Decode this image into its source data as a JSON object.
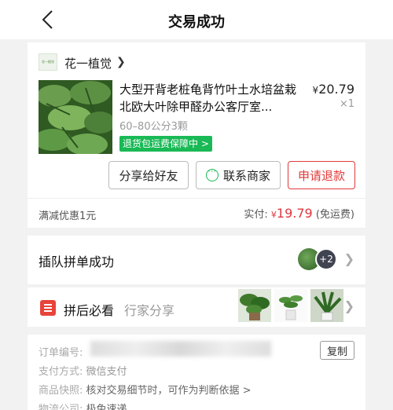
{
  "nav": {
    "title": "交易成功"
  },
  "shop": {
    "logo_text": "花一植觉",
    "name": "花一植觉"
  },
  "product": {
    "name": "大型开背老桩龟背竹叶土水培盆栽北欧大叶除甲醛办公客厅室...",
    "price_symbol": "¥",
    "price": "20.79",
    "quantity": "×1",
    "spec": "60–80公分3颗",
    "badge": "退货包运费保障中 >"
  },
  "actions": {
    "share": "分享给好友",
    "contact": "联系商家",
    "refund": "申请退款"
  },
  "summary": {
    "discount": "满减优惠1元",
    "pay_label": "实付:",
    "pay_symbol": "¥",
    "pay_amount": "19.79",
    "shipping": "(免运费)"
  },
  "group": {
    "text": "插队拼单成功",
    "more_count": "+2"
  },
  "must_see": {
    "title": "拼后必看",
    "subtitle": "行家分享"
  },
  "order": {
    "id_label": "订单编号:",
    "copy_label": "复制",
    "pay_method_label": "支付方式:",
    "pay_method_value": "微信支付",
    "snapshot_label": "商品快照:",
    "snapshot_value": "核对交易细节时，可作为判断依据 >",
    "logistics_label": "物流公司:",
    "logistics_value": "极兔速递"
  },
  "colors": {
    "accent_red": "#e0383e",
    "badge_green": "#19b955"
  }
}
